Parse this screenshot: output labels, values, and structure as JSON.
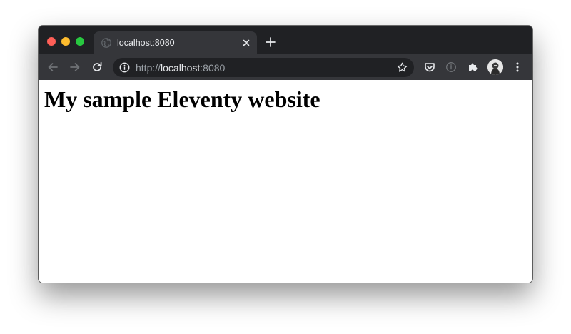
{
  "browser": {
    "tab": {
      "title": "localhost:8080"
    },
    "address_bar": {
      "scheme": "http://",
      "host": "localhost",
      "port": ":8080"
    },
    "icons": {
      "back": "arrow-left-icon",
      "forward": "arrow-right-icon",
      "reload": "reload-icon",
      "site_info": "info-icon",
      "bookmark": "star-icon",
      "pocket": "pocket-icon",
      "extension_info": "info-icon",
      "extensions": "puzzle-icon",
      "profile": "avatar",
      "menu": "kebab-menu-icon",
      "new_tab": "plus-icon",
      "close_tab": "close-icon",
      "favicon": "globe-icon"
    },
    "colors": {
      "tabstrip": "#202124",
      "toolbar": "#35363a",
      "traffic_close": "#ff5f57",
      "traffic_minimize": "#febc2e",
      "traffic_maximize": "#28c840"
    }
  },
  "page": {
    "heading": "My sample Eleventy website"
  }
}
